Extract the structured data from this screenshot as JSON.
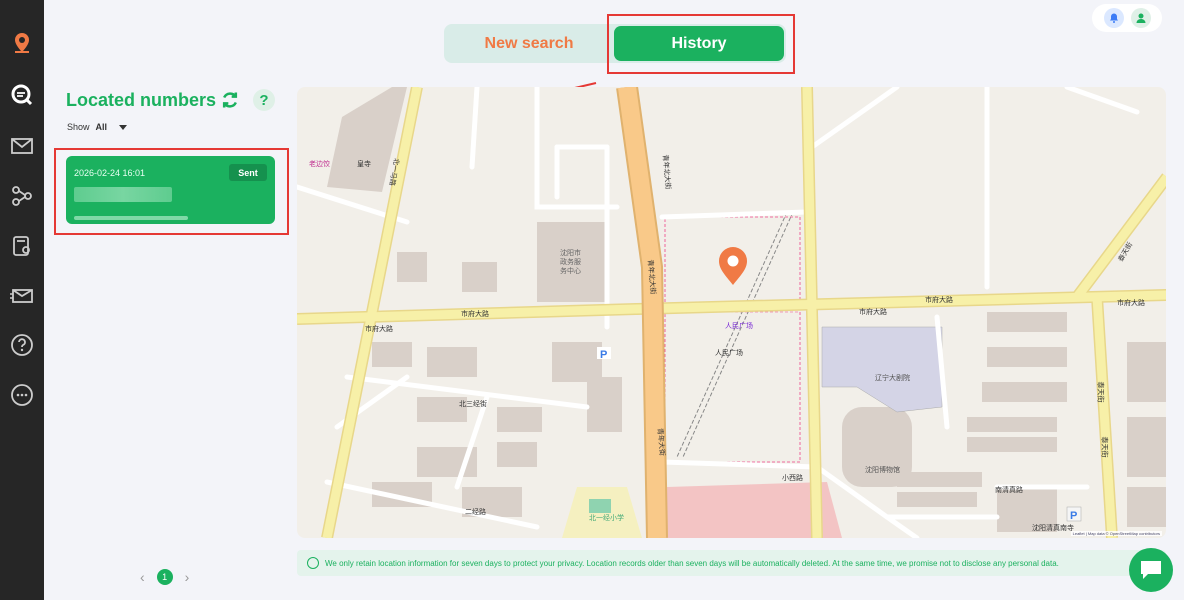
{
  "tabs": {
    "new_search": "New search",
    "history": "History"
  },
  "panel": {
    "title": "Located numbers",
    "help": "?",
    "show_label": "Show",
    "show_value": "All"
  },
  "record": {
    "datetime": "2026-02-24 16:01",
    "status": "Sent"
  },
  "pager": {
    "prev": "‹",
    "current": "1",
    "next": "›"
  },
  "map": {
    "labels": {
      "shifu_road_1": "市府大路",
      "shifu_road_2": "市府大路",
      "shifu_road_3": "市府大路",
      "shifu_road_4": "市府大路",
      "shifu_road_5": "市府大路",
      "shifu_road_6": "市府大路",
      "renmin_square": "人民广场",
      "renmin_square_2": "人民广场",
      "gov_center": "沈阳市\n政务服\n务中心",
      "huangsi": "皇寺",
      "laobian": "老边饺",
      "beisanjing": "北三经街",
      "xiaoxi": "小西路",
      "nanqing": "南清真路",
      "liaoning_theater": "辽宁大剧院",
      "museum": "沈阳博物馆",
      "mosque": "沈阳清真南寺",
      "school": "北一经小学",
      "erjing": "二经路",
      "qingnian_1": "青年北大街",
      "qingnian_2": "青年北大街",
      "qingnian_3": "青年大街",
      "beiyi": "北一马路",
      "taixin": "泰天街",
      "taixin_2": "泰天街",
      "taixin_3": "泰天街"
    },
    "attribution": "Leaflet | Map data © OpenStreetMap contributors"
  },
  "notice": "We only retain location information for seven days to protect your privacy. Location records older than seven days will be automatically deleted. At the same time, we promise not to disclose any personal data.",
  "colors": {
    "brand": "#1bb15f",
    "accent": "#f07a45",
    "highlight": "#e53935"
  }
}
